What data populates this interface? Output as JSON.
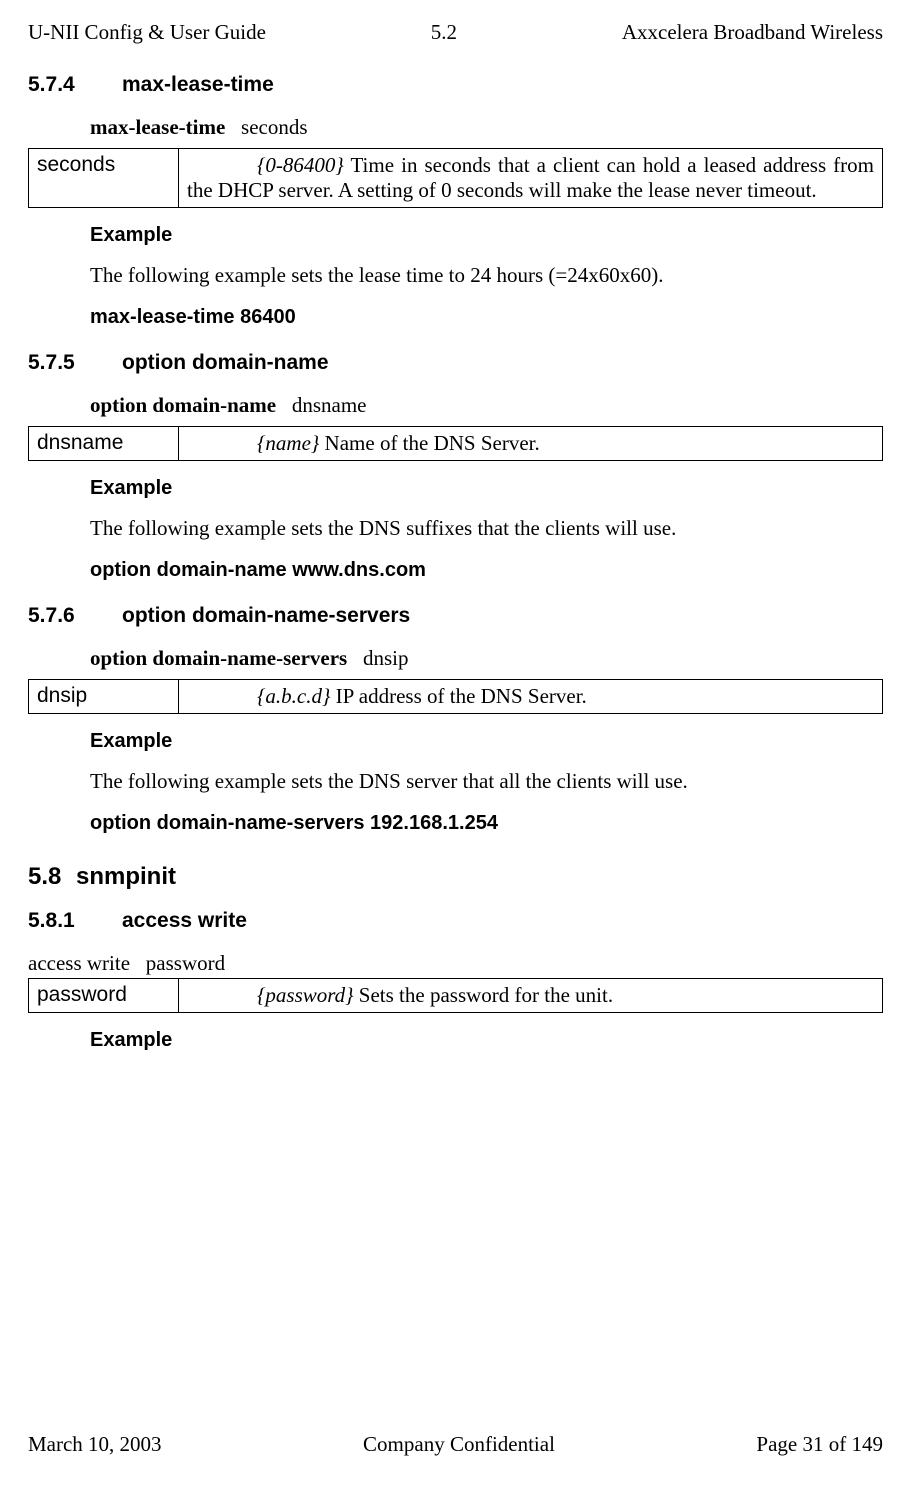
{
  "header": {
    "left": "U-NII Config & User Guide",
    "center": "5.2",
    "right": "Axxcelera Broadband Wireless"
  },
  "sections": {
    "s574": {
      "num": "5.7.4",
      "title": "max-lease-time",
      "syntax_bold": "max-lease-time",
      "syntax_arg": "seconds",
      "param_name": "seconds",
      "param_range": "{0-86400}",
      "param_desc": " Time in seconds that a client can hold a leased address from the DHCP server. A setting of 0 seconds will make the lease never timeout.",
      "example_label": "Example",
      "example_text": "The following example sets the lease time to 24 hours (=24x60x60).",
      "example_code": "max-lease-time   86400"
    },
    "s575": {
      "num": "5.7.5",
      "title": "option domain-name",
      "syntax_bold": "option domain-name",
      "syntax_arg": "dnsname",
      "param_name": "dnsname",
      "param_range": "{name}",
      "param_desc": " Name of the DNS Server.",
      "example_label": "Example",
      "example_text": "The following example sets the DNS suffixes that the clients will use.",
      "example_code": "option   domain-name   www.dns.com"
    },
    "s576": {
      "num": "5.7.6",
      "title": "option domain-name-servers",
      "syntax_bold": "option   domain-name-servers",
      "syntax_arg": "dnsip",
      "param_name": "dnsip",
      "param_range": "{a.b.c.d}",
      "param_desc": " IP address of the DNS Server.",
      "example_label": "Example",
      "example_text": "The following example sets the DNS server that all the clients will use.",
      "example_code": "option   domain-name-servers   192.168.1.254"
    },
    "s58": {
      "num": "5.8",
      "title": "snmpinit"
    },
    "s581": {
      "num": "5.8.1",
      "title": "access write",
      "syntax_bold": "access write",
      "syntax_arg": "password",
      "param_name": "password",
      "param_range": "{password}",
      "param_desc": " Sets the password for the unit.",
      "example_label": "Example"
    }
  },
  "footer": {
    "left": "March 10, 2003",
    "center": "Company Confidential",
    "right": "Page 31 of 149"
  }
}
